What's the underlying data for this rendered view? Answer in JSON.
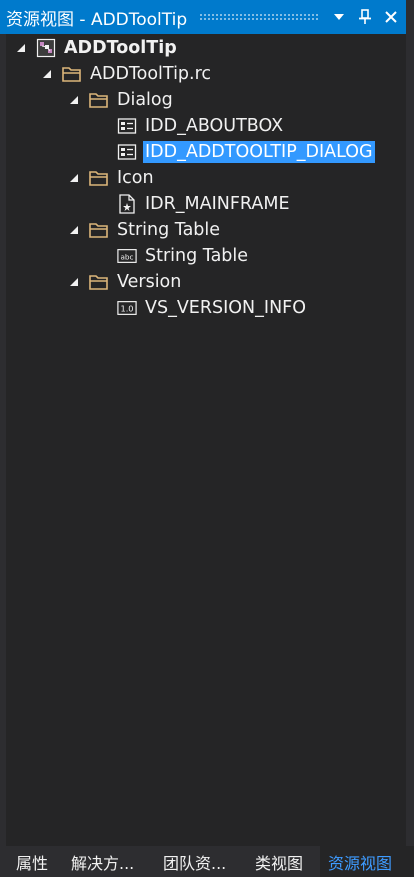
{
  "window": {
    "title": "资源视图 - ADDToolTip"
  },
  "colors": {
    "accent": "#007acc",
    "selection": "#3399ff",
    "folder": "#dcb67a",
    "active_tab": "#3e9bff"
  },
  "tree": {
    "root": "ADDToolTip",
    "rc_file": "ADDToolTip.rc",
    "folders": {
      "dialog": "Dialog",
      "icon": "Icon",
      "string_table": "String Table",
      "version": "Version"
    },
    "items": {
      "about_box": "IDD_ABOUTBOX",
      "main_dialog": "IDD_ADDTOOLTIP_DIALOG",
      "mainframe": "IDR_MAINFRAME",
      "string_table": "String Table",
      "version_info": "VS_VERSION_INFO"
    },
    "icons": {
      "root": "project-icon",
      "folder": "folder-icon",
      "dialog": "dialog-resource-icon",
      "icon": "icon-resource-icon",
      "string": "string-table-icon",
      "version": "version-icon"
    },
    "selected": "IDD_ADDTOOLTIP_DIALOG"
  },
  "tabs": {
    "properties": "属性",
    "solution": "解决方...",
    "team": "团队资...",
    "class_view": "类视图",
    "resource_view": "资源视图"
  }
}
